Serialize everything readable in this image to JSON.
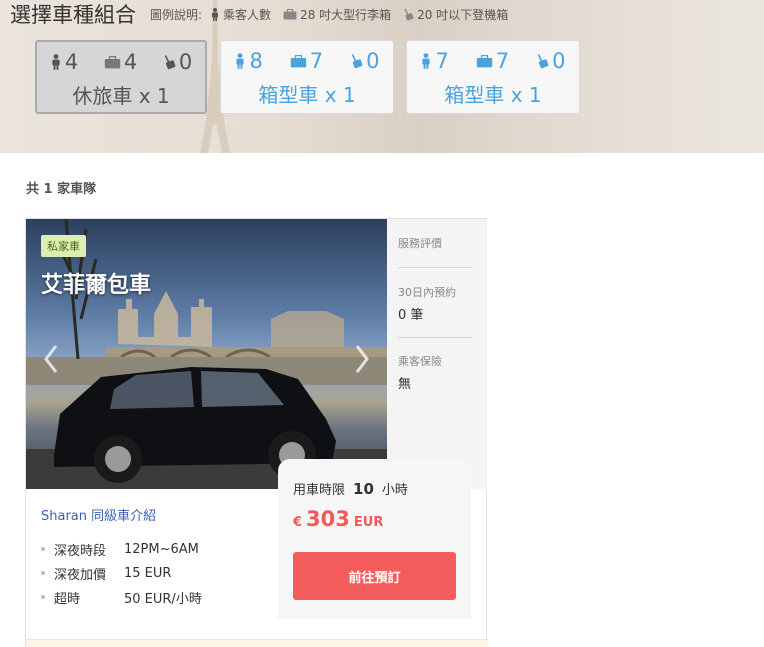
{
  "header": {
    "title": "選擇車種組合",
    "legend_label": "圖例說明:",
    "legend": [
      {
        "icon": "person-icon",
        "text": "乘客人數"
      },
      {
        "icon": "suitcase-icon",
        "text": "28 吋大型行李箱"
      },
      {
        "icon": "carry-on-icon",
        "text": "20 吋以下登機箱"
      }
    ],
    "combos": [
      {
        "passengers": "4",
        "large_luggage": "4",
        "carry_on": "0",
        "label": "休旅車 x 1",
        "selected": true
      },
      {
        "passengers": "8",
        "large_luggage": "7",
        "carry_on": "0",
        "label": "箱型車 x 1",
        "selected": false
      },
      {
        "passengers": "7",
        "large_luggage": "7",
        "carry_on": "0",
        "label": "箱型車 x 1",
        "selected": false
      }
    ]
  },
  "results": {
    "count_text": "共 1 家車隊"
  },
  "card": {
    "badge": "私家車",
    "title": "艾菲爾包車",
    "side": {
      "rating_label": "服務評價",
      "bookings_label": "30日內預約",
      "bookings_value": "0 筆",
      "insurance_label": "乘客保險",
      "insurance_value": "無"
    },
    "car_link": "Sharan 同級車介紹",
    "specs": [
      {
        "k": "深夜時段",
        "v": "12PM~6AM"
      },
      {
        "k": "深夜加價",
        "v": "15 EUR"
      },
      {
        "k": "超時",
        "v": "50 EUR/小時"
      }
    ],
    "price": {
      "limit_label": "用車時限",
      "limit_hours": "10",
      "limit_unit": "小時",
      "currency_symbol": "€",
      "amount": "303",
      "currency_code": "EUR"
    },
    "book_button": "前往預訂"
  },
  "colors": {
    "accent_blue": "#4aa3df",
    "price_red": "#f05a5a",
    "button_red": "#f55d5d",
    "badge_green": "#dcefb1",
    "link_blue": "#3a5fb8"
  }
}
